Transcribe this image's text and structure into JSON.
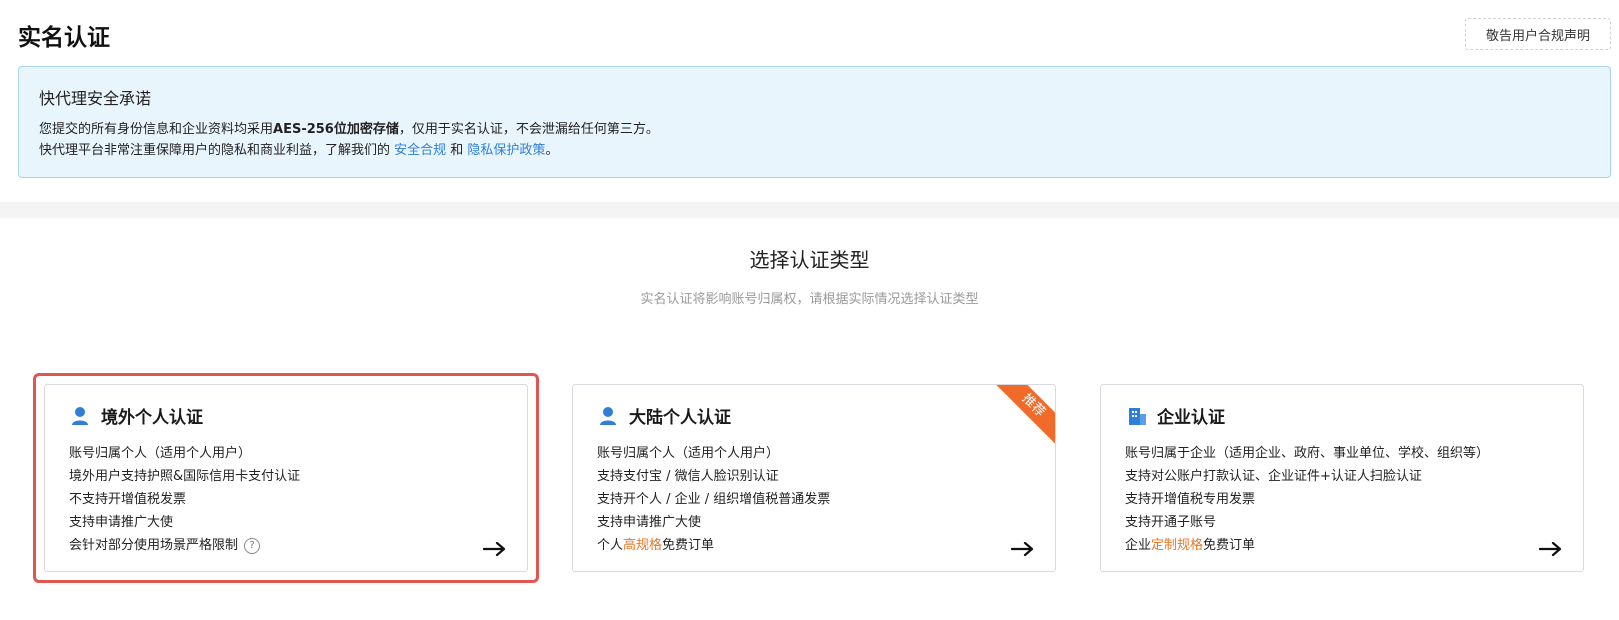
{
  "header": {
    "title": "实名认证",
    "notice_button": "敬告用户合规声明"
  },
  "alert": {
    "title": "快代理安全承诺",
    "line1_pre": "您提交的所有身份信息和企业资料均采用",
    "line1_bold": "AES-256位加密存储",
    "line1_post": "，仅用于实名认证，不会泄漏给任何第三方。",
    "line2_pre": "快代理平台非常注重保障用户的隐私和商业利益，了解我们的 ",
    "link_security": "安全合规",
    "line2_mid": " 和 ",
    "link_privacy": "隐私保护政策",
    "line2_post": "。"
  },
  "section": {
    "title": "选择认证类型",
    "subtitle": "实名认证将影响账号归属权，请根据实际情况选择认证类型"
  },
  "cards": [
    {
      "title": "境外个人认证",
      "icon": "user-icon",
      "lines": [
        "账号归属个人（适用个人用户）",
        "境外用户支持护照&国际信用卡支付认证",
        "不支持开增值税发票",
        "支持申请推广大使",
        "会针对部分使用场景严格限制"
      ]
    },
    {
      "title": "大陆个人认证",
      "icon": "user-icon",
      "badge": "推荐",
      "lines": [
        "账号归属个人（适用个人用户）",
        "支持支付宝 / 微信人脸识别认证",
        "支持开个人 / 企业 / 组织增值税普通发票",
        "支持申请推广大使"
      ],
      "last_pre": "个人",
      "last_highlight": "高规格",
      "last_post": "免费订单"
    },
    {
      "title": "企业认证",
      "icon": "building-icon",
      "lines": [
        "账号归属于企业（适用企业、政府、事业单位、学校、组织等）",
        "支持对公账户打款认证、企业证件+认证人扫脸认证",
        "支持开增值税专用发票",
        "支持开通子账号"
      ],
      "last_pre": "企业",
      "last_highlight": "定制规格",
      "last_post": "免费订单"
    }
  ],
  "colors": {
    "accent_blue": "#2f7fd8",
    "highlight_orange": "#e8782a",
    "selection_red": "#e0574f",
    "badge_orange": "#f06a2a"
  }
}
